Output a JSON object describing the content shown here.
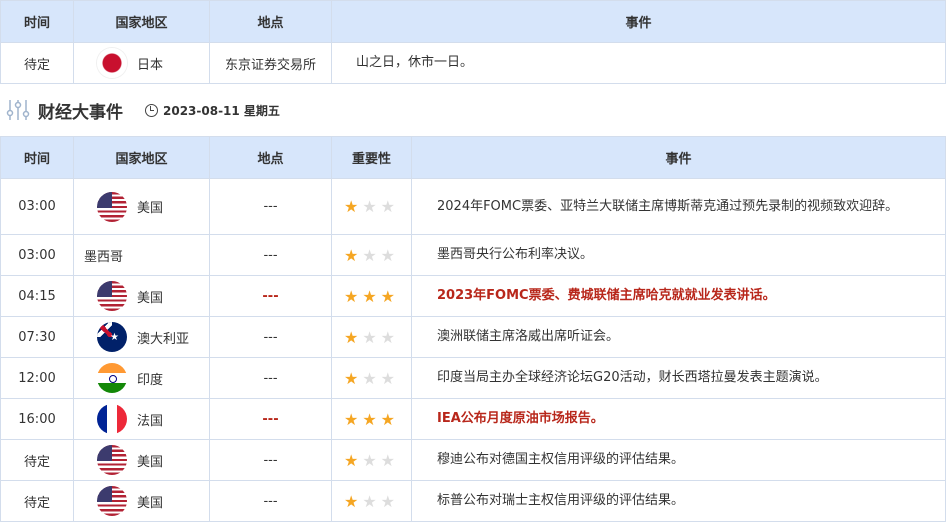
{
  "holiday_table": {
    "headers": [
      "时间",
      "国家地区",
      "地点",
      "事件"
    ],
    "rows": [
      {
        "time": "待定",
        "country": "日本",
        "flag": "jp",
        "location": "东京证券交易所",
        "event": "山之日，休市一日。"
      }
    ]
  },
  "section": {
    "title": "财经大事件",
    "date": "2023-08-11 星期五",
    "icon": "sliders-icon"
  },
  "events_table": {
    "headers": [
      "时间",
      "国家地区",
      "地点",
      "重要性",
      "事件"
    ],
    "rows": [
      {
        "time": "03:00",
        "country": "美国",
        "flag": "us",
        "location": "---",
        "importance": 1,
        "event": "2024年FOMC票委、亚特兰大联储主席博斯蒂克通过预先录制的视频致欢迎辞。",
        "highlight": false
      },
      {
        "time": "03:00",
        "country": "墨西哥",
        "flag": "",
        "location": "---",
        "importance": 1,
        "event": "墨西哥央行公布利率决议。",
        "highlight": false
      },
      {
        "time": "04:15",
        "country": "美国",
        "flag": "us",
        "location": "---",
        "importance": 3,
        "event": "2023年FOMC票委、费城联储主席哈克就就业发表讲话。",
        "highlight": true
      },
      {
        "time": "07:30",
        "country": "澳大利亚",
        "flag": "au",
        "location": "---",
        "importance": 1,
        "event": "澳洲联储主席洛威出席听证会。",
        "highlight": false
      },
      {
        "time": "12:00",
        "country": "印度",
        "flag": "in",
        "location": "---",
        "importance": 1,
        "event": "印度当局主办全球经济论坛G20活动，财长西塔拉曼发表主题演说。",
        "highlight": false
      },
      {
        "time": "16:00",
        "country": "法国",
        "flag": "fr",
        "location": "---",
        "importance": 3,
        "event": "IEA公布月度原油市场报告。",
        "highlight": true
      },
      {
        "time": "待定",
        "country": "美国",
        "flag": "us",
        "location": "---",
        "importance": 1,
        "event": "穆迪公布对德国主权信用评级的评估结果。",
        "highlight": false
      },
      {
        "time": "待定",
        "country": "美国",
        "flag": "us",
        "location": "---",
        "importance": 1,
        "event": "标普公布对瑞士主权信用评级的评估结果。",
        "highlight": false
      }
    ]
  },
  "colors": {
    "header_bg": "#d7e6fb",
    "highlight": "#b8271b",
    "star_on": "#f5a623",
    "star_off": "#dddddd"
  }
}
